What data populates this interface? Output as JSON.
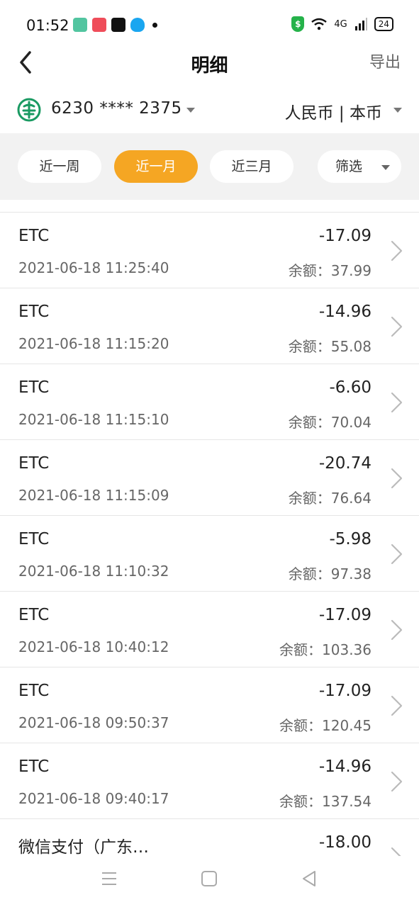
{
  "status_bar": {
    "time": "01:52",
    "network": "4G",
    "battery": "24"
  },
  "header": {
    "title": "明细",
    "export_label": "导出"
  },
  "account": {
    "number": "6230 **** 2375",
    "currency": "人民币 | 本币"
  },
  "filters": {
    "week": "近一周",
    "month": "近一月",
    "three_months": "近三月",
    "filter": "筛选",
    "active": "month"
  },
  "transactions": [
    {
      "name": "ETC",
      "date": "2021-06-18 11:25:40",
      "amount": "-17.09",
      "balance": "余额：37.99"
    },
    {
      "name": "ETC",
      "date": "2021-06-18 11:15:20",
      "amount": "-14.96",
      "balance": "余额：55.08"
    },
    {
      "name": "ETC",
      "date": "2021-06-18 11:15:10",
      "amount": "-6.60",
      "balance": "余额：70.04"
    },
    {
      "name": "ETC",
      "date": "2021-06-18 11:15:09",
      "amount": "-20.74",
      "balance": "余额：76.64"
    },
    {
      "name": "ETC",
      "date": "2021-06-18 11:10:32",
      "amount": "-5.98",
      "balance": "余额：97.38"
    },
    {
      "name": "ETC",
      "date": "2021-06-18 10:40:12",
      "amount": "-17.09",
      "balance": "余额：103.36"
    },
    {
      "name": "ETC",
      "date": "2021-06-18 09:50:37",
      "amount": "-17.09",
      "balance": "余额：120.45"
    },
    {
      "name": "ETC",
      "date": "2021-06-18 09:40:17",
      "amount": "-14.96",
      "balance": "余额：137.54"
    },
    {
      "name": "微信支付（广东…",
      "date": "",
      "amount": "-18.00",
      "balance": ""
    }
  ],
  "colors": {
    "accent": "#f5a623",
    "bank_green": "#1a9a62",
    "filter_bg": "#f2f2f2"
  }
}
